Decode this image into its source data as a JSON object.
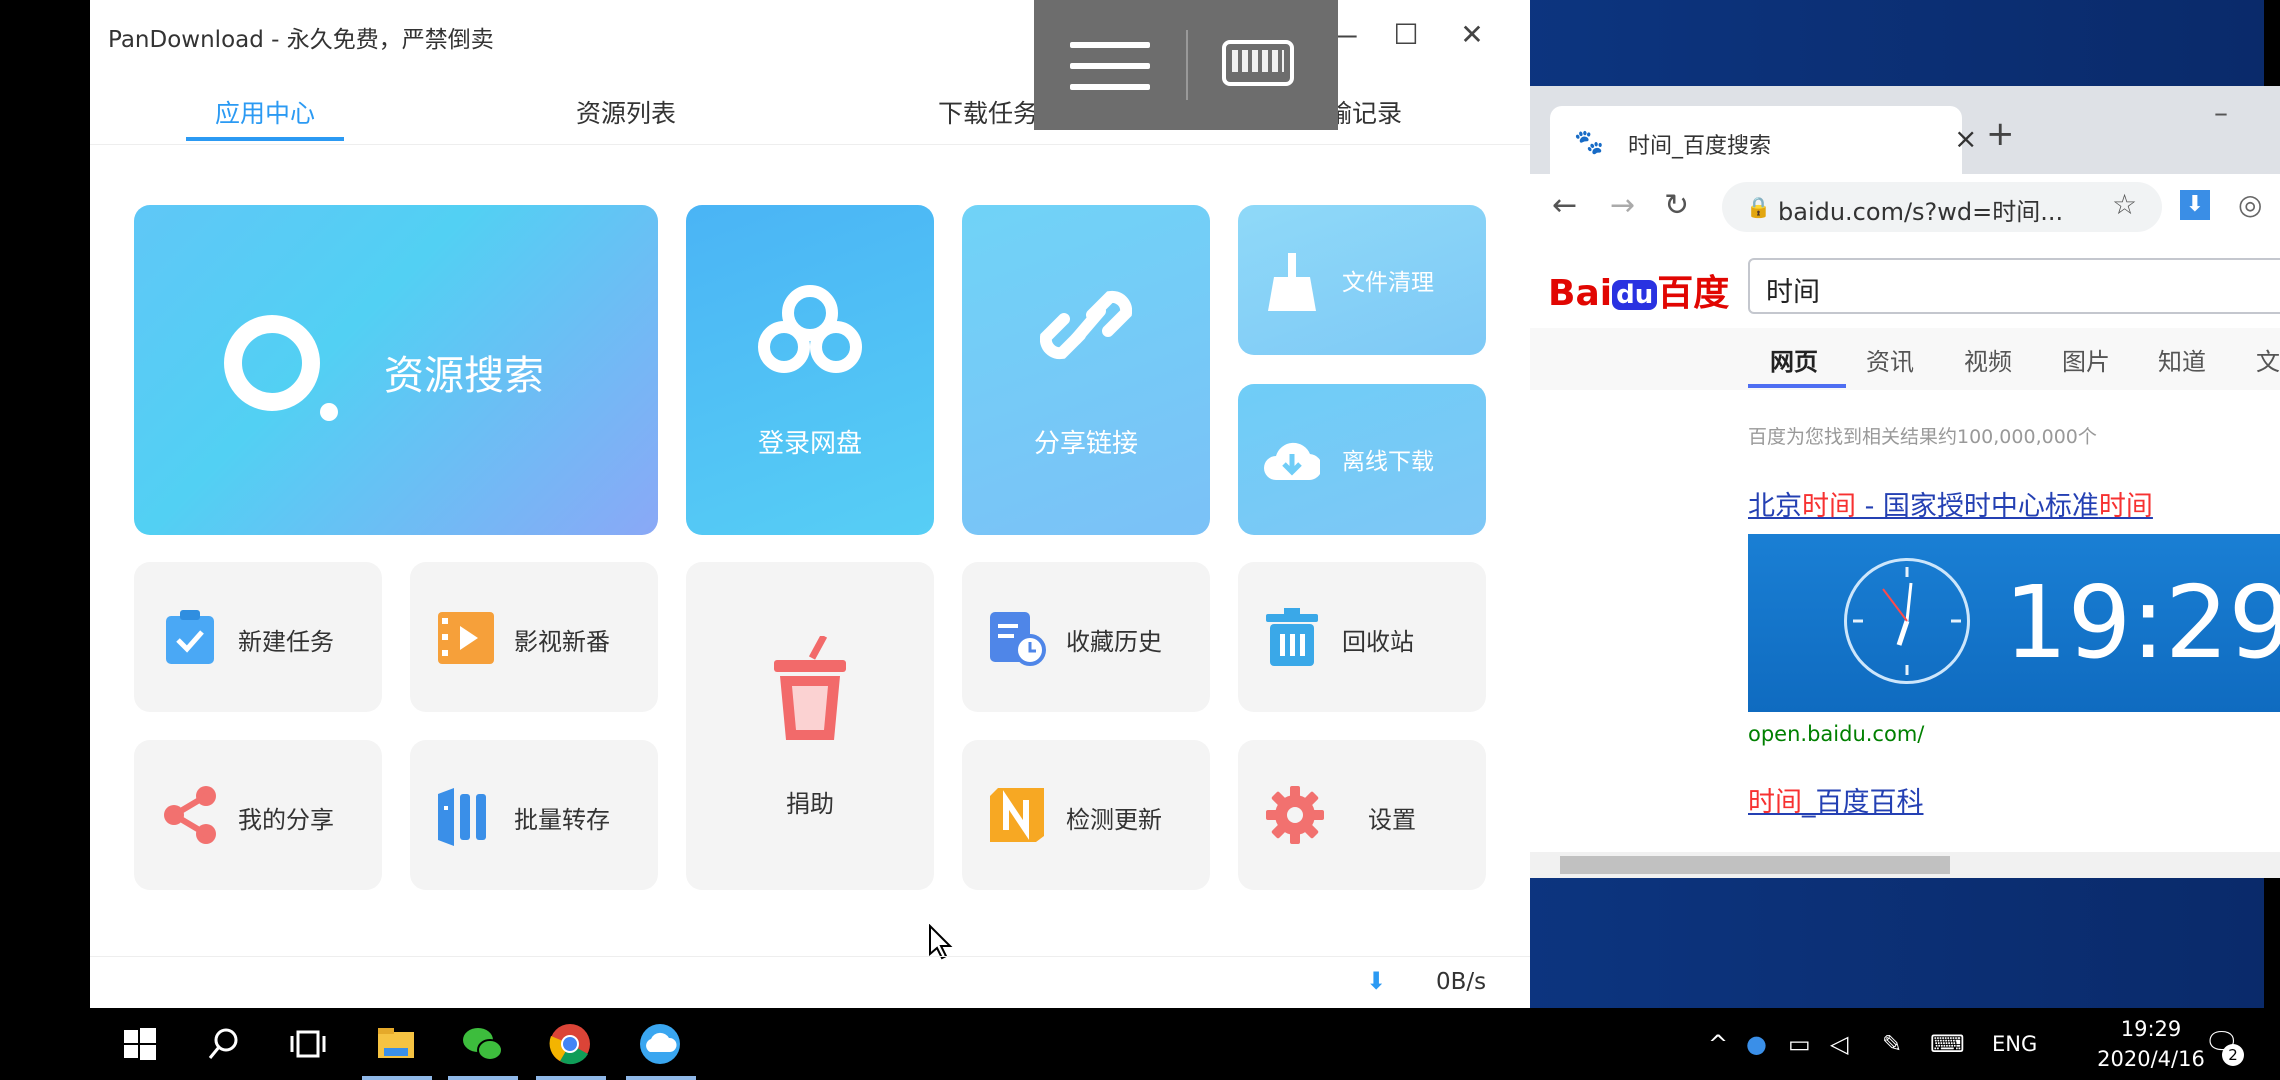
{
  "pandownload": {
    "title": "PanDownload - 永久免费，严禁倒卖",
    "tabs": [
      "应用中心",
      "资源列表",
      "下载任务",
      "传输记录"
    ],
    "tiles": {
      "search": "资源搜索",
      "login": "登录网盘",
      "share_link": "分享链接",
      "file_clean": "文件清理",
      "offline_download": "离线下载",
      "new_task": "新建任务",
      "movies": "影视新番",
      "donate": "捐助",
      "favorites_history": "收藏历史",
      "recycle": "回收站",
      "my_share": "我的分享",
      "batch_save": "批量转存",
      "check_update": "检测更新",
      "settings": "设置"
    },
    "status_speed": "0B/s"
  },
  "chrome": {
    "tab_title": "时间_百度搜索",
    "url": "baidu.com/s?wd=时间...",
    "baidu": {
      "logo_bai": "Bai",
      "logo_du": "du",
      "logo_cn": "百度",
      "query": "时间",
      "tabs": [
        "网页",
        "资讯",
        "视频",
        "图片",
        "知道",
        "文"
      ],
      "result_count": "百度为您找到相关结果约100,000,000个",
      "r1_pre": "北京",
      "r1_em1": "时间",
      "r1_mid": " - 国家授时中心标准",
      "r1_em2": "时间",
      "clock_time": "19:29",
      "r1_url": "open.baidu.com/",
      "r2_em": "时间",
      "r2_rest": "_百度百科"
    }
  },
  "taskbar": {
    "lang": "ENG",
    "time": "19:29",
    "date": "2020/4/16",
    "notif_count": "2"
  }
}
